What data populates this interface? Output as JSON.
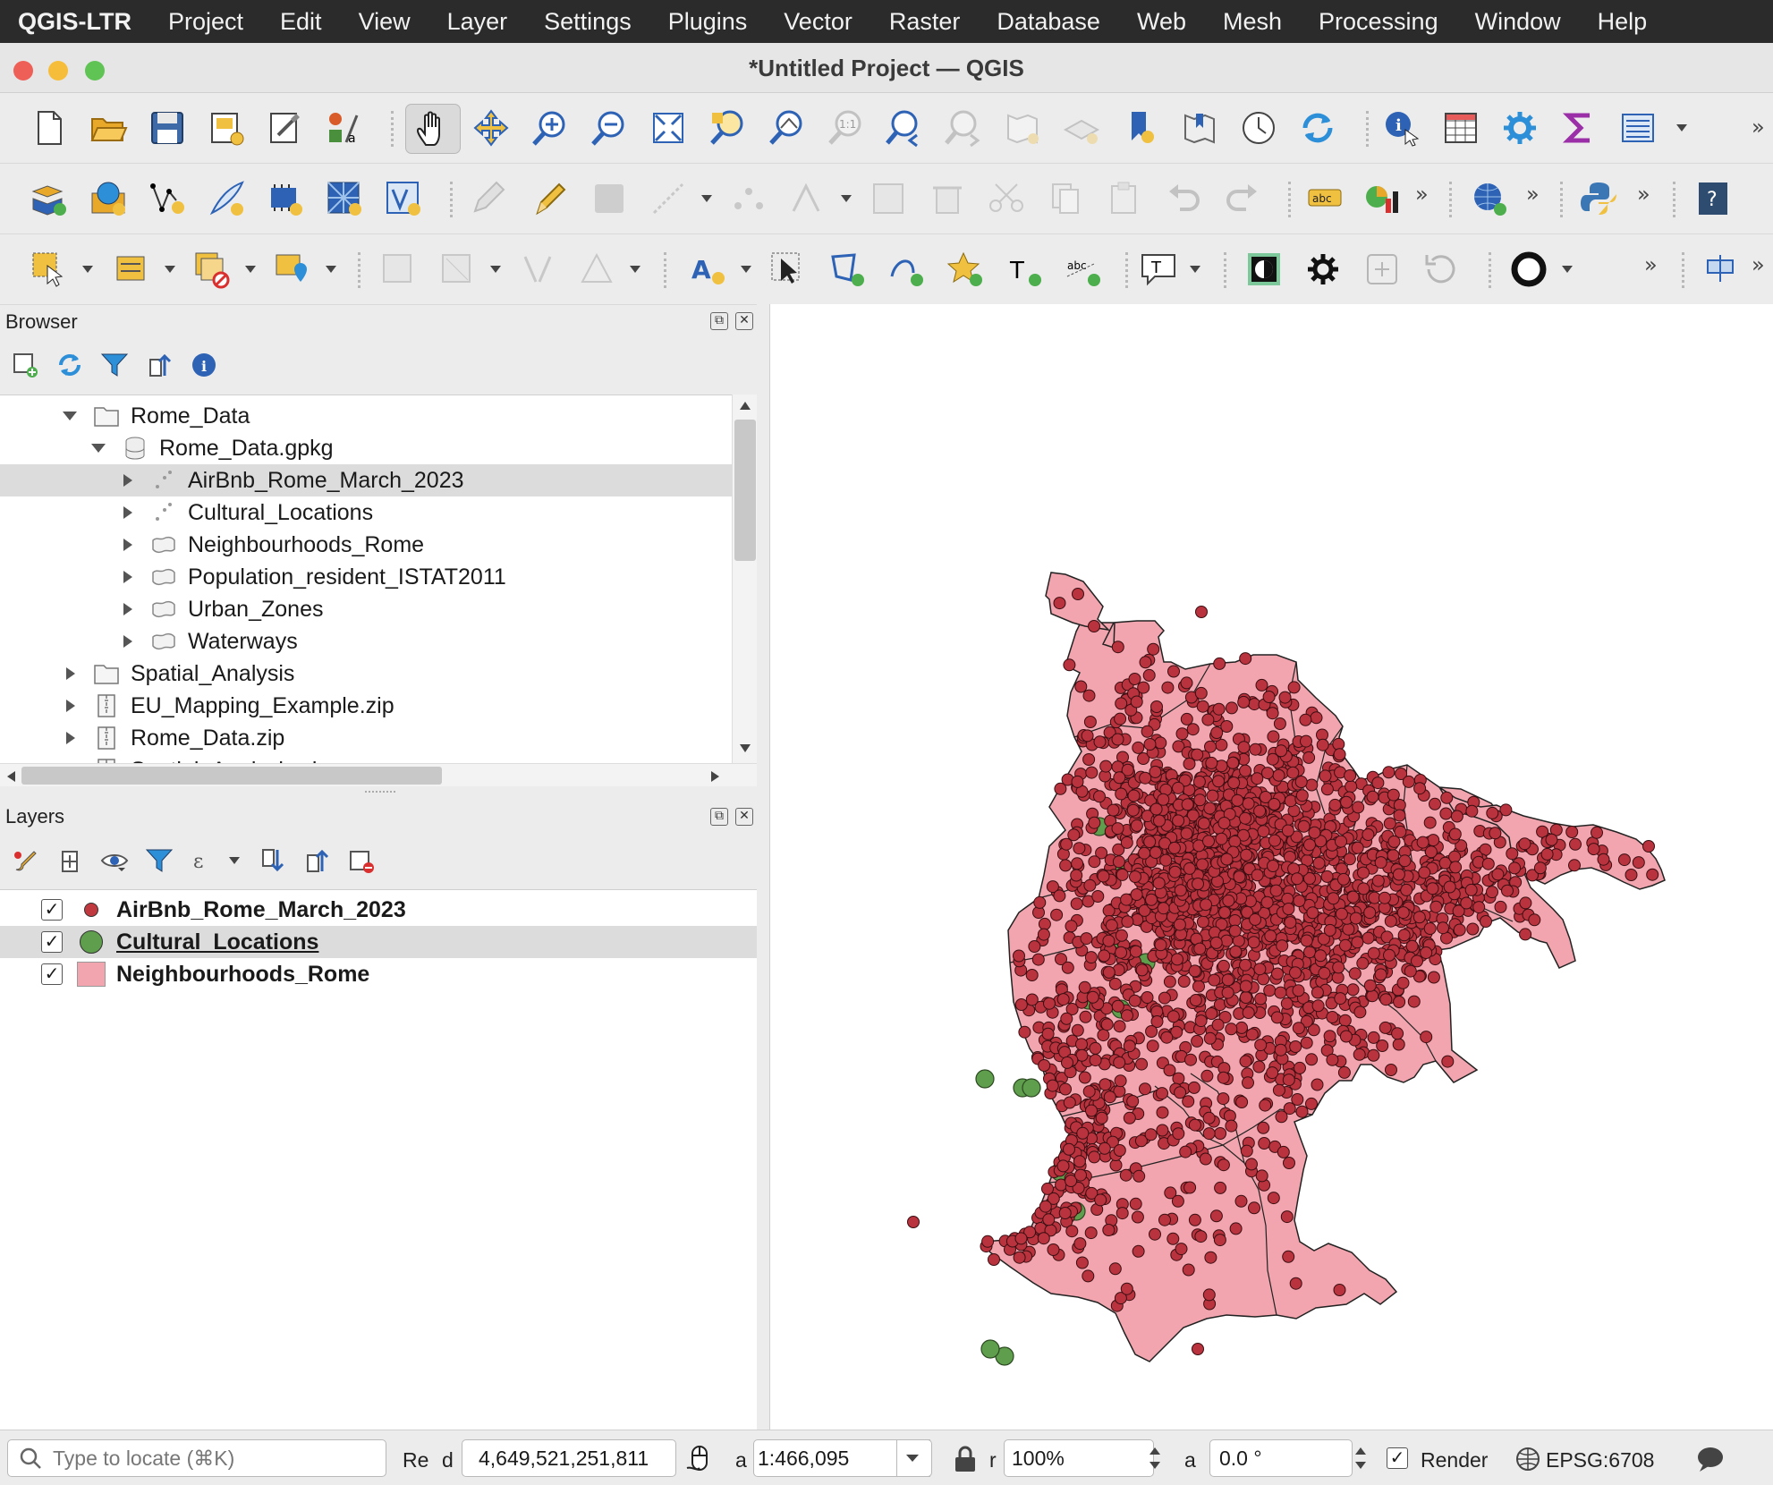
{
  "menubar": {
    "app": "QGIS-LTR",
    "items": [
      "Project",
      "Edit",
      "View",
      "Layer",
      "Settings",
      "Plugins",
      "Vector",
      "Raster",
      "Database",
      "Web",
      "Mesh",
      "Processing",
      "Window",
      "Help"
    ]
  },
  "window": {
    "title": "*Untitled Project — QGIS"
  },
  "browser": {
    "title": "Browser",
    "tree": [
      {
        "label": "Rome_Data",
        "icon": "folder-icon",
        "level": 1,
        "expanded": true
      },
      {
        "label": "Rome_Data.gpkg",
        "icon": "database-icon",
        "level": 2,
        "expanded": true
      },
      {
        "label": "AirBnb_Rome_March_2023",
        "icon": "point-layer-icon",
        "level": 3,
        "selected": true
      },
      {
        "label": "Cultural_Locations",
        "icon": "point-layer-icon",
        "level": 3
      },
      {
        "label": "Neighbourhoods_Rome",
        "icon": "polygon-layer-icon",
        "level": 3
      },
      {
        "label": "Population_resident_ISTAT2011",
        "icon": "polygon-layer-icon",
        "level": 3
      },
      {
        "label": "Urban_Zones",
        "icon": "polygon-layer-icon",
        "level": 3
      },
      {
        "label": "Waterways",
        "icon": "polygon-layer-icon",
        "level": 3
      },
      {
        "label": "Spatial_Analysis",
        "icon": "folder-icon",
        "level": 1
      },
      {
        "label": "EU_Mapping_Example.zip",
        "icon": "zip-icon",
        "level": 1
      },
      {
        "label": "Rome_Data.zip",
        "icon": "zip-icon",
        "level": 1
      },
      {
        "label": "Spatial_Analysis.zip",
        "icon": "zip-icon",
        "level": 1
      }
    ]
  },
  "layers": {
    "title": "Layers",
    "items": [
      {
        "label": "AirBnb_Rome_March_2023",
        "checked": true,
        "symbol": "point",
        "color": "#c0393f"
      },
      {
        "label": "Cultural_Locations",
        "checked": true,
        "symbol": "point",
        "color": "#5f9e4c",
        "selected": true
      },
      {
        "label": "Neighbourhoods_Rome",
        "checked": true,
        "symbol": "polygon",
        "color": "#f2a5ae"
      }
    ]
  },
  "map": {
    "polygon_fill": "#f2a5ae",
    "airbnb_color": "#b8333d",
    "cultural_color": "#5f9e4c"
  },
  "statusbar": {
    "locate_placeholder": "Type to locate (⌘K)",
    "coordinate_label": "Re",
    "coordinate_label2": "d",
    "coordinate_value": "4,649,521,251,811",
    "scale_label": "a",
    "scale_value": "1:466,095",
    "magnifier_label": "r",
    "magnifier_value": "100%",
    "rotation_label": "a",
    "rotation_value": "0.0 °",
    "render_label": "Render",
    "render_checked": true,
    "crs": "EPSG:6708"
  },
  "check_mark": "✓"
}
